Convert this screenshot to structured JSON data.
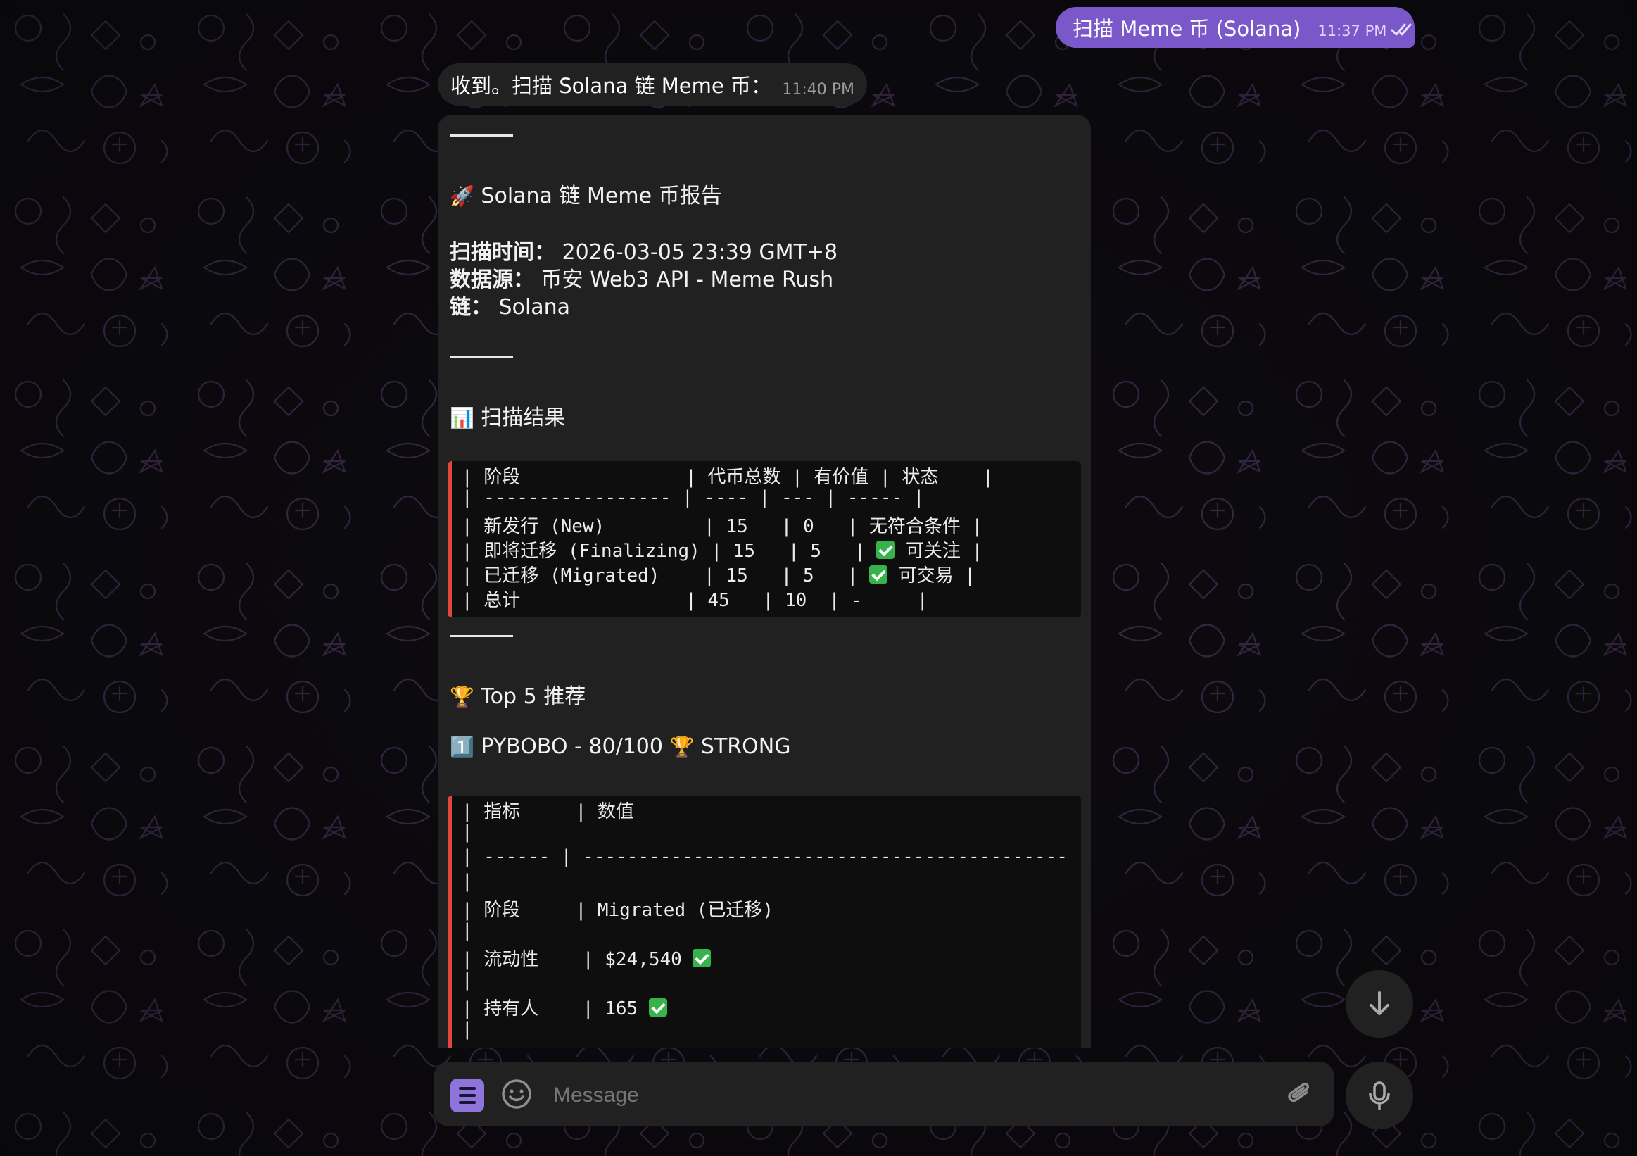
{
  "colors": {
    "outgoing_bubble": "#7b58c9",
    "incoming_bubble": "#212121",
    "code_accent": "#e0473f",
    "check": "#36b34a",
    "menu_button": "#8f74dc"
  },
  "outgoing": {
    "text": "扫描 Meme 币 (Solana)",
    "time": "11:37 PM",
    "status_icon": "double-check-icon"
  },
  "reply_short": {
    "text": "收到。扫描 Solana 链 Meme 币：",
    "time": "11:40 PM"
  },
  "report": {
    "title_emoji": "🚀",
    "title": "Solana 链 Meme 币报告",
    "scan_time_label": "扫描时间：",
    "scan_time": "2026-03-05 23:39 GMT+8",
    "source_label": "数据源：",
    "source": "币安 Web3 API - Meme Rush",
    "chain_label": "链：",
    "chain": "Solana",
    "results_emoji": "📊",
    "results_title": "扫描结果",
    "results_table": [
      {
        "text": "| 阶段               | 代币总数 | 有价值 | 状态    |",
        "check": false
      },
      {
        "text": "| ----------------- | ---- | --- | ----- |",
        "check": false
      },
      {
        "text": "| 新发行 (New)         | 15   | 0   | 无符合条件 |",
        "check": false
      },
      {
        "pre": "| 即将迁移 (Finalizing) | 15   | 5   | ",
        "post": " 可关注 |",
        "check": true
      },
      {
        "pre": "| 已迁移 (Migrated)    | 15   | 5   | ",
        "post": " 可交易 |",
        "check": true
      },
      {
        "text": "| 总计               | 45   | 10  | -     |",
        "check": false
      }
    ],
    "top_emoji": "🏆",
    "top_title": "Top 5 推荐",
    "first_pick_num": "1️⃣",
    "first_pick": "PYBOBO - 80/100",
    "first_pick_emoji": "🏆",
    "first_pick_grade": "STRONG",
    "metrics_table": [
      {
        "text": "| 指标     | 数值",
        "check": false
      },
      {
        "text": "|",
        "check": false
      },
      {
        "text": "| ------ | --------------------------------------------",
        "check": false
      },
      {
        "text": "|",
        "check": false
      },
      {
        "text": "| 阶段     | Migrated (已迁移)",
        "check": false
      },
      {
        "text": "|",
        "check": false
      },
      {
        "pre": "| 流动性    | $24,540 ",
        "post": "",
        "check": true
      },
      {
        "text": "|",
        "check": false
      },
      {
        "pre": "| 持有人    | 165 ",
        "post": "",
        "check": true
      },
      {
        "text": "|",
        "check": false
      }
    ]
  },
  "composer": {
    "placeholder": "Message"
  },
  "icons": {
    "menu": "menu-icon",
    "emoji": "smiley-icon",
    "attach": "paperclip-icon",
    "mic": "microphone-icon",
    "scroll": "arrow-down-icon"
  }
}
